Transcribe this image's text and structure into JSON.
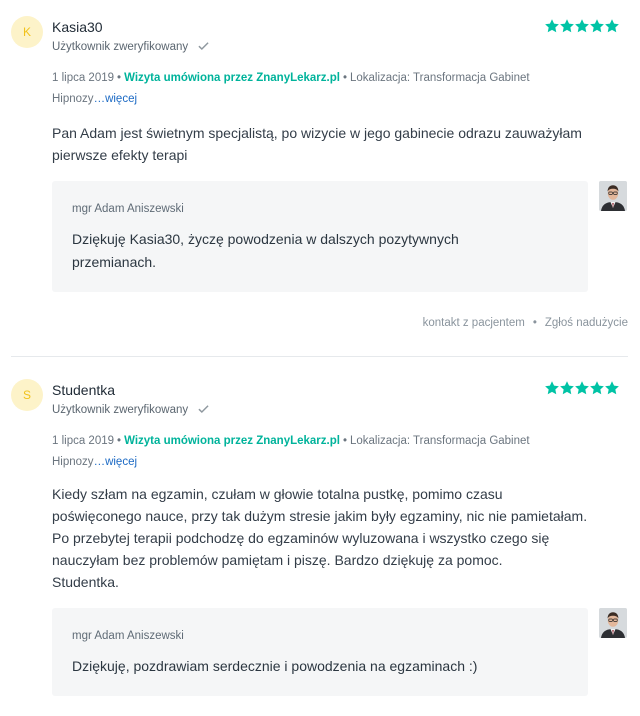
{
  "reviews": [
    {
      "avatar_letter": "K",
      "name": "Kasia30",
      "verified": "Użytkownik zweryfikowany",
      "date": "1 lipca 2019",
      "visit": "Wizyta umówiona przez ZnanyLekarz.pl",
      "location_line1": "Lokalizacja: Transformacja Gabinet",
      "location_line2": "Hipnozy",
      "more": "…więcej",
      "text_lines": [
        "Pan Adam jest świetnym specjalistą, po wizycie w jego gabinecie odrazu zauważyłam",
        "pierwsze efekty terapi"
      ],
      "reply": {
        "author": "mgr Adam Aniszewski",
        "text_lines": [
          "Dziękuję Kasia30, życzę powodzenia w dalszych pozytywnych",
          "przemianach."
        ]
      },
      "actions": [
        "kontakt z pacjentem",
        "Zgłoś nadużycie"
      ]
    },
    {
      "avatar_letter": "S",
      "name": "Studentka",
      "verified": "Użytkownik zweryfikowany",
      "date": "1 lipca 2019",
      "visit": "Wizyta umówiona przez ZnanyLekarz.pl",
      "location_line1": "Lokalizacja: Transformacja Gabinet",
      "location_line2": "Hipnozy",
      "more": "…więcej",
      "text_lines": [
        "Kiedy szłam na egzamin, czułam w głowie totalna pustkę, pomimo czasu",
        "poświęconego nauce, przy tak dużym stresie jakim były egzaminy, nic nie pamietałam.",
        "Po przebytej terapii podchodzę do egzaminów wyluzowana i wszystko czego się",
        "nauczyłam bez problemów pamiętam i piszę. Bardzo dziękuję za pomoc.",
        "Studentka."
      ],
      "reply": {
        "author": "mgr Adam Aniszewski",
        "text_lines": [
          "Dziękuję, pozdrawiam serdecznie i powodzenia na egzaminach :)"
        ]
      }
    }
  ],
  "rating_stars": 5,
  "colors": {
    "accent": "#00c3a5",
    "link": "#1c6ac4",
    "avatar_bg": "#fdf3c9",
    "avatar_fg": "#f1c21b"
  },
  "icons": [
    "star-icon",
    "check-icon",
    "doctor-photo"
  ]
}
